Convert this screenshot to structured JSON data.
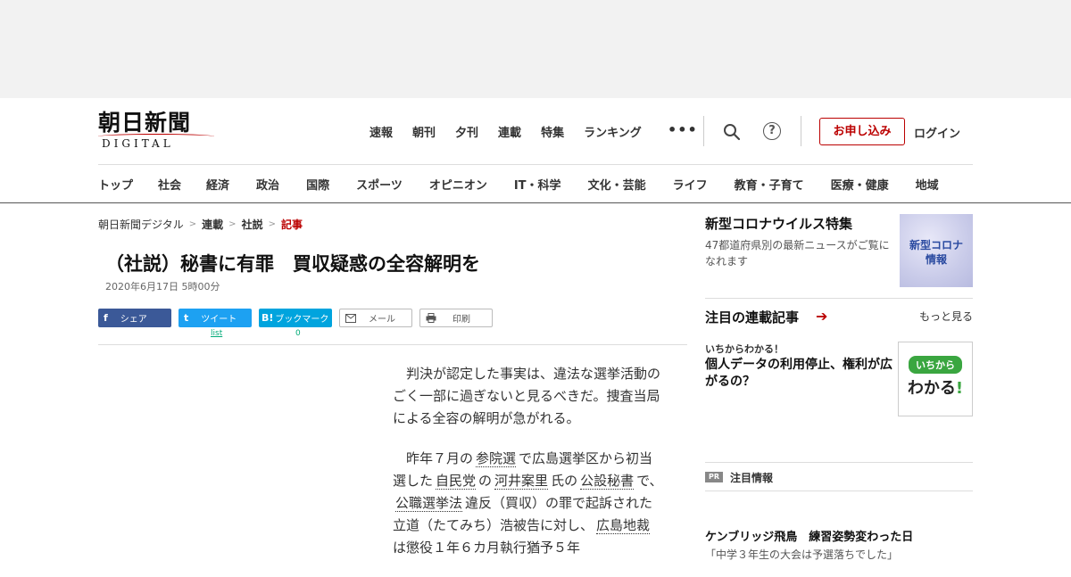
{
  "header": {
    "logo_main": "朝日新聞",
    "logo_sub": "DIGITAL",
    "nav": [
      "速報",
      "朝刊",
      "夕刊",
      "連載",
      "特集",
      "ランキング"
    ],
    "more": "•••",
    "help": "?",
    "apply_label": "お申し込み",
    "login_label": "ログイン"
  },
  "categories": [
    "トップ",
    "社会",
    "経済",
    "政治",
    "国際",
    "スポーツ",
    "オピニオン",
    "IT・科学",
    "文化・芸能",
    "ライフ",
    "教育・子育て",
    "医療・健康",
    "地域"
  ],
  "breadcrumb": {
    "home": "朝日新聞デジタル",
    "level1": "連載",
    "level2": "社説",
    "current": "記事",
    "sep": ">"
  },
  "article": {
    "title": "（社説）秘書に有罪　買収疑惑の全容解明を",
    "date": "2020年6月17日 5時00分",
    "share": {
      "facebook": "シェア",
      "facebook_icon": "f",
      "twitter": "ツイート",
      "twitter_icon": "t",
      "bookmark": "ブックマーク",
      "bookmark_icon": "B!",
      "mail": "メール",
      "print": "印刷",
      "tweet_count": "list",
      "bookmark_count": "0"
    },
    "p1": "判決が認定した事実は、違法な選挙活動のごく一部に過ぎないと見るべきだ。捜査当局による全容の解明が急がれる。",
    "p2": {
      "t1": "昨年７月の",
      "l1": "参院選",
      "t2": "で広島選挙区から初当選した",
      "l2": "自民党",
      "t3": "の",
      "l3": "河井案里",
      "t4": "氏の",
      "l4": "公設秘書",
      "t5": "で、",
      "l5": "公職選挙法",
      "t6": "違反（買収）の罪で起訴された立道（たてみち）浩被告に対し、",
      "l6": "広島地裁",
      "t7": "は懲役１年６カ月執行猶予５年"
    }
  },
  "sidebar": {
    "corona_title": "新型コロナウイルス特集",
    "corona_desc": "47都道府県別の最新ニュースがご覧になれます",
    "corona_thumb_line1": "新型コロナ",
    "corona_thumb_line2": "情報",
    "serial_heading": "注目の連載記事",
    "serial_more": "もっと見る",
    "serial_kicker": "いちからわかる！",
    "serial_headline": "個人データの利用停止、権利が広がるの？",
    "serial_thumb_pill": "いちから",
    "serial_thumb_big": "わかる",
    "serial_thumb_mark": "!",
    "pr_badge": "PR",
    "pr_label": "注目情報",
    "pr_headline": "ケンブリッジ飛鳥　練習姿勢変わった日",
    "pr_sub": "「中学３年生の大会は予選落ちでした」"
  },
  "colors": {
    "brand_red": "#bb0000",
    "facebook": "#3b5998",
    "twitter": "#1da1f2",
    "hatena": "#00a4de"
  }
}
